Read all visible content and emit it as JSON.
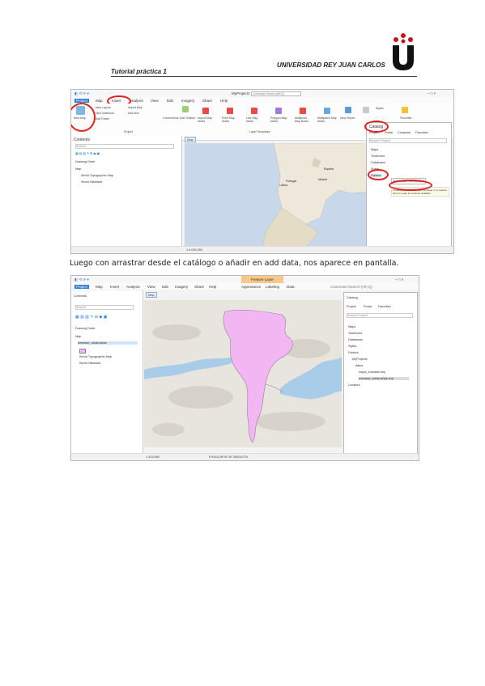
{
  "header": {
    "left": "Tutorial práctica 1",
    "right": "UNIVERSIDAD REY JUAN CARLOS"
  },
  "caption": "Luego con arrastrar desde el catálogo o añadir en add data, nos aparece en pantalla.",
  "shot1": {
    "title": "MyProject1",
    "search": "Command Search (Alt+Q)",
    "menu": [
      "Project",
      "Map",
      "Insert",
      "Analysis",
      "View",
      "Edit",
      "Imagery",
      "Share",
      "Help"
    ],
    "ribbon": {
      "new_map": "New Map",
      "new_layout": "New Layout",
      "new_notebook": "New Notebook",
      "add_folder": "Add Folder",
      "import_map": "Import Map",
      "add_item": "Add Item",
      "connections": "Connections",
      "add_toolbox": "Add Toolbox",
      "group_project": "Project",
      "group_layer": "Layer Templates",
      "templates": [
        "Import Map Notes",
        "Point Map Notes",
        "Line Map Notes",
        "Polygon Map Notes",
        "Multipoint Map Notes",
        "Multipatch Map Notes"
      ],
      "new_report": "New Report",
      "styles": "Styles",
      "favorites": "Favorites"
    },
    "contents": {
      "title": "Contents",
      "search": "Search",
      "drawing_order": "Drawing Order",
      "items": [
        "Map",
        "World Topographic Map",
        "World Hillshade"
      ]
    },
    "map_tab": "Map",
    "map_labels": {
      "madrid": "Madrid",
      "lisboa": "Lisboa",
      "espana": "España",
      "portugal": "Portugal"
    },
    "catalog": {
      "title": "Catalog",
      "tabs": [
        "Project",
        "Portal",
        "Computer",
        "Favorites"
      ],
      "search": "Search Project",
      "items": [
        "Maps",
        "Toolboxes",
        "Databases",
        "Styles",
        "Folders"
      ],
      "menu_item": "Add Folder Connection",
      "tooltip": "Connect to a folder on your computer or a network drive to make its contents available"
    },
    "scale": "1:4,000,000"
  },
  "shot2": {
    "title": "MyProject1",
    "tab_active": "Feature Layer",
    "menu": [
      "Project",
      "Map",
      "Insert",
      "Analysis",
      "View",
      "Edit",
      "Imagery",
      "Share",
      "Help",
      "Appearance",
      "Labeling",
      "Data"
    ],
    "search": "Command Search (Alt+Q)",
    "contents": {
      "title": "Contents",
      "search": "Search",
      "drawing_order": "Drawing Order",
      "items": [
        "Map",
        "embalse_valdecañas",
        "World Topographic Map",
        "World Hillshade"
      ]
    },
    "map_tab": "Map",
    "catalog": {
      "title": "Catalog",
      "tabs": [
        "Project",
        "Portal",
        "Favorites"
      ],
      "search": "Search Project",
      "items": [
        "Maps",
        "Toolboxes",
        "Databases",
        "Styles",
        "Folders",
        "MyProject1",
        "datos",
        "mapa_embalse.shp",
        "embalse_valdecañas.shp",
        "Locators"
      ]
    },
    "scale": "1:103,560",
    "coords": "5.9431196°W 39.7682413°N"
  },
  "colors": {
    "accent_red": "#e3201b",
    "esri_blue": "#2c7bd3",
    "lake_pink": "#f2b6f2"
  }
}
